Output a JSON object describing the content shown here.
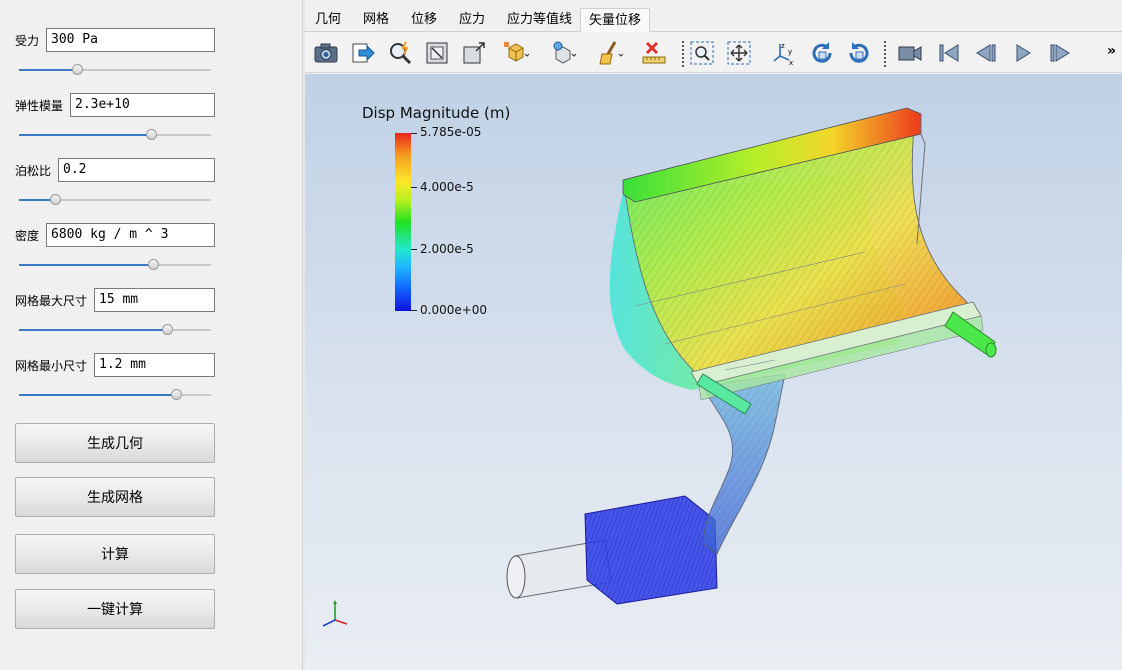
{
  "params": [
    {
      "label": "受力",
      "value": "300 Pa",
      "slider": 0.3
    },
    {
      "label": "弹性模量",
      "value": "2.3e+10",
      "slider": 0.69
    },
    {
      "label": "泊松比",
      "value": "0.2",
      "slider": 0.19
    },
    {
      "label": "密度",
      "value": "6800 kg / m ^ 3",
      "slider": 0.7
    },
    {
      "label": "网格最大尺寸",
      "value": "15 mm",
      "slider": 0.77
    },
    {
      "label": "网格最小尺寸",
      "value": "1.2 mm",
      "slider": 0.82
    }
  ],
  "buttons": {
    "generate_geometry": "生成几何",
    "generate_mesh": "生成网格",
    "compute": "计算",
    "one_click": "一键计算"
  },
  "tabs": [
    "几何",
    "网格",
    "位移",
    "应力",
    "应力等值线",
    "矢量位移"
  ],
  "active_tab": "矢量位移",
  "toolbar": {
    "icons": [
      "camera-icon",
      "export-icon",
      "pick-icon",
      "zoom-box-icon",
      "zoom-extents-icon",
      "display-mode-icon",
      "lighting-icon",
      "clean-icon",
      "measure-icon",
      "zoom-select-icon",
      "fit-all-icon",
      "axis-orient-icon",
      "rotate-cw-icon",
      "rotate-ccw-icon",
      "camera-record-icon",
      "first-frame-icon",
      "prev-frame-icon",
      "play-icon",
      "last-frame-icon"
    ],
    "more": "»"
  },
  "legend": {
    "title": "Disp Magnitude (m)",
    "labels": [
      "5.785e-05",
      "4.000e-5",
      "2.000e-5",
      "0.000e+00"
    ]
  },
  "colors": {
    "accent": "#3b79c4",
    "viewport_top": "#c0d1e6",
    "viewport_bottom": "#eaeef3"
  }
}
